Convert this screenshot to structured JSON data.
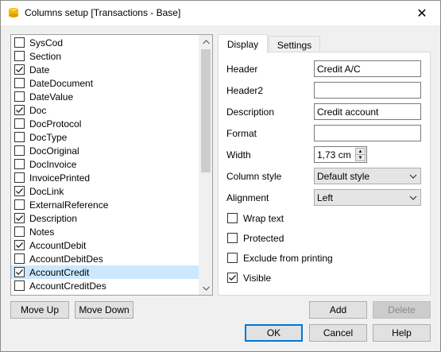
{
  "window": {
    "title": "Columns setup [Transactions - Base]",
    "close_glyph": "✕"
  },
  "columns": [
    {
      "label": "SysCod",
      "checked": false,
      "selected": false
    },
    {
      "label": "Section",
      "checked": false,
      "selected": false
    },
    {
      "label": "Date",
      "checked": true,
      "selected": false
    },
    {
      "label": "DateDocument",
      "checked": false,
      "selected": false
    },
    {
      "label": "DateValue",
      "checked": false,
      "selected": false
    },
    {
      "label": "Doc",
      "checked": true,
      "selected": false
    },
    {
      "label": "DocProtocol",
      "checked": false,
      "selected": false
    },
    {
      "label": "DocType",
      "checked": false,
      "selected": false
    },
    {
      "label": "DocOriginal",
      "checked": false,
      "selected": false
    },
    {
      "label": "DocInvoice",
      "checked": false,
      "selected": false
    },
    {
      "label": "InvoicePrinted",
      "checked": false,
      "selected": false
    },
    {
      "label": "DocLink",
      "checked": true,
      "selected": false
    },
    {
      "label": "ExternalReference",
      "checked": false,
      "selected": false
    },
    {
      "label": "Description",
      "checked": true,
      "selected": false
    },
    {
      "label": "Notes",
      "checked": false,
      "selected": false
    },
    {
      "label": "AccountDebit",
      "checked": true,
      "selected": false
    },
    {
      "label": "AccountDebitDes",
      "checked": false,
      "selected": false
    },
    {
      "label": "AccountCredit",
      "checked": true,
      "selected": true
    },
    {
      "label": "AccountCreditDes",
      "checked": false,
      "selected": false
    }
  ],
  "list_buttons": {
    "move_up": "Move Up",
    "move_down": "Move Down"
  },
  "tabs": [
    {
      "label": "Display",
      "active": true
    },
    {
      "label": "Settings",
      "active": false
    }
  ],
  "display": {
    "header_label": "Header",
    "header_value": "Credit A/C",
    "header2_label": "Header2",
    "header2_value": "",
    "description_label": "Description",
    "description_value": "Credit account",
    "format_label": "Format",
    "format_value": "",
    "width_label": "Width",
    "width_value": "1,73 cm",
    "column_style_label": "Column style",
    "column_style_value": "Default style",
    "alignment_label": "Alignment",
    "alignment_value": "Left",
    "options": [
      {
        "label": "Wrap text",
        "checked": false
      },
      {
        "label": "Protected",
        "checked": false
      },
      {
        "label": "Exclude from printing",
        "checked": false
      },
      {
        "label": "Visible",
        "checked": true
      }
    ]
  },
  "buttons": {
    "add": "Add",
    "delete": "Delete",
    "ok": "OK",
    "cancel": "Cancel",
    "help": "Help"
  },
  "colors": {
    "selection": "#cce8ff",
    "accent": "#0078d7",
    "app_icon": "#f5b800"
  }
}
